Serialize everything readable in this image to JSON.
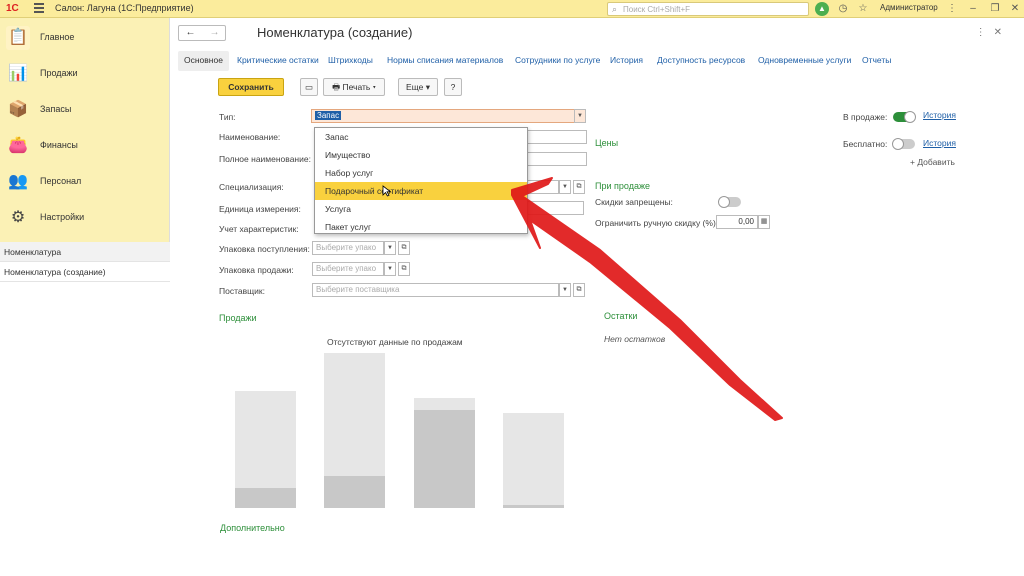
{
  "app": {
    "logo": "1С",
    "title": "Салон: Лагуна  (1С:Предприятие)",
    "search_placeholder": "Поиск Ctrl+Shift+F",
    "user": "Администратор",
    "accent_color": "#fbec9c"
  },
  "sidebar": {
    "items": [
      {
        "label": "Главное",
        "icon": "clipboard-icon"
      },
      {
        "label": "Продажи",
        "icon": "chart-icon"
      },
      {
        "label": "Запасы",
        "icon": "boxes-icon"
      },
      {
        "label": "Финансы",
        "icon": "wallet-icon"
      },
      {
        "label": "Персонал",
        "icon": "people-icon"
      },
      {
        "label": "Настройки",
        "icon": "gear-icon"
      }
    ],
    "open_windows": [
      "Номенклатура",
      "Номенклатура (создание)"
    ]
  },
  "form": {
    "title": "Номенклатура (создание)",
    "tabs": [
      "Основное",
      "Критические остатки",
      "Штрихкоды",
      "Нормы списания материалов",
      "Сотрудники по услуге",
      "История",
      "Доступность ресурсов",
      "Одновременные услуги",
      "Отчеты"
    ],
    "toolbar": {
      "save": "Сохранить",
      "print": "Печать",
      "more": "Еще",
      "help": "?"
    },
    "fields": {
      "type_label": "Тип:",
      "type_value": "Запас",
      "name_label": "Наименование:",
      "full_name_label": "Полное наименование:",
      "spec_label": "Специализация:",
      "unit_label": "Единица измерения:",
      "char_label": "Учет характеристик:",
      "pack_in_label": "Упаковка поступления:",
      "pack_in_placeholder": "Выберите упако",
      "pack_out_label": "Упаковка продажи:",
      "pack_out_placeholder": "Выберите упако",
      "supplier_label": "Поставщик:",
      "supplier_placeholder": "Выберите поставщика"
    },
    "dropdown": {
      "items": [
        "Запас",
        "Имущество",
        "Набор услуг",
        "Подарочный сертификат",
        "Услуга",
        "Пакет услуг"
      ],
      "highlighted_index": 3
    },
    "right": {
      "in_sale_label": "В продаже:",
      "in_sale_link": "История",
      "free_label": "Бесплатно:",
      "free_link": "История",
      "add_link": "+ Добавить",
      "prices_title": "Цены",
      "on_sale_title": "При продаже",
      "discounts_forbidden": "Скидки запрещены:",
      "manual_discount_label": "Ограничить ручную скидку (%):",
      "manual_discount_value": "0,00"
    },
    "sales": {
      "title": "Продажи",
      "caption": "Отсутствуют данные по продажам"
    },
    "stock": {
      "title": "Остатки",
      "note": "Нет остатков"
    },
    "extra_title": "Дополнительно"
  }
}
